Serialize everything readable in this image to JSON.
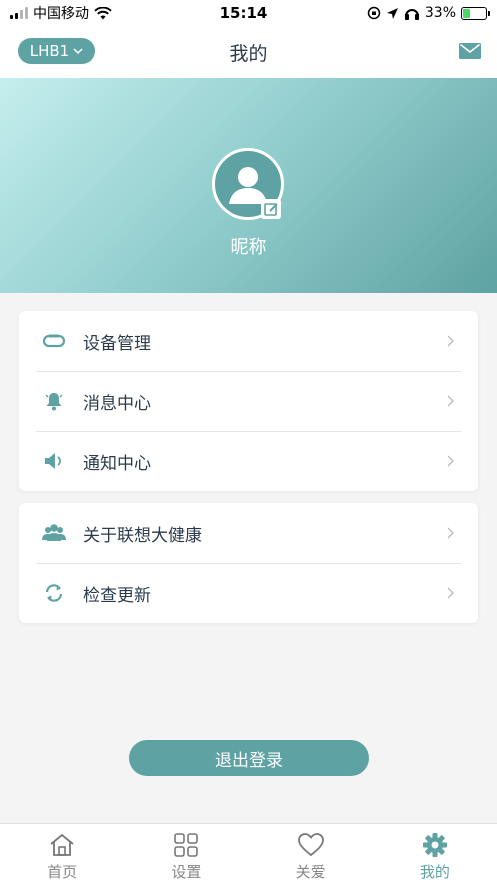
{
  "status_bar": {
    "carrier": "中国移动",
    "time": "15:14",
    "battery_percent": "33%",
    "battery_level": 0.33
  },
  "nav": {
    "device_label": "LHB1",
    "title": "我的",
    "mail_icon": "mail-icon"
  },
  "profile": {
    "nickname": "昵称"
  },
  "menu_group_1": [
    {
      "icon": "device-band-icon",
      "label": "设备管理"
    },
    {
      "icon": "bell-icon",
      "label": "消息中心"
    },
    {
      "icon": "speaker-icon",
      "label": "通知中心"
    }
  ],
  "menu_group_2": [
    {
      "icon": "users-icon",
      "label": "关于联想大健康"
    },
    {
      "icon": "refresh-icon",
      "label": "检查更新"
    }
  ],
  "logout_label": "退出登录",
  "tabs": [
    {
      "icon": "home-icon",
      "label": "首页",
      "active": false
    },
    {
      "icon": "grid-icon",
      "label": "设置",
      "active": false
    },
    {
      "icon": "heart-icon",
      "label": "关爱",
      "active": false
    },
    {
      "icon": "gear-icon",
      "label": "我的",
      "active": true
    }
  ],
  "colors": {
    "accent": "#5fa2a3",
    "text": "#2b3b4b"
  }
}
